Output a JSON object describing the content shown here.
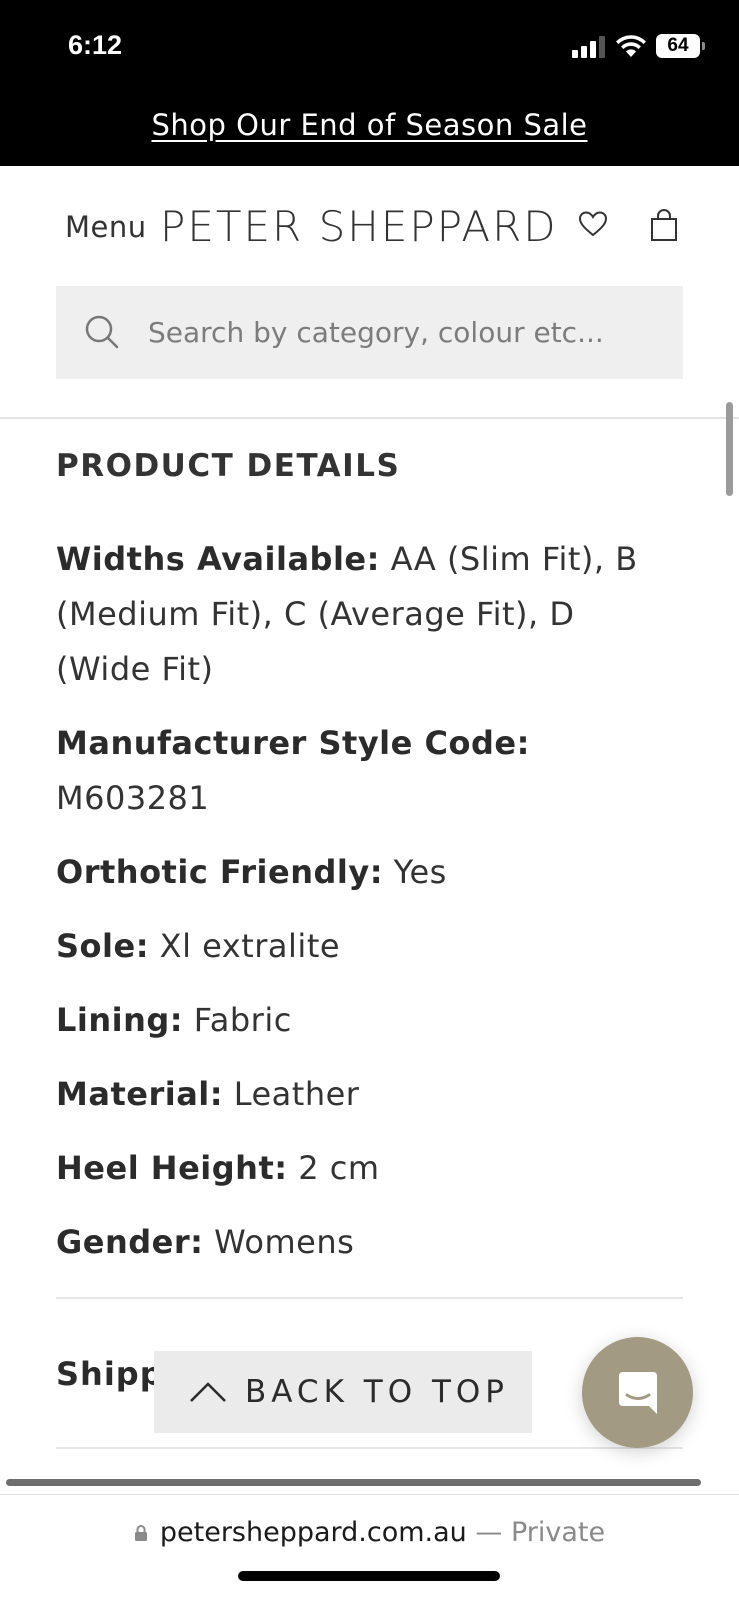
{
  "status_bar": {
    "time": "6:12",
    "battery": "64",
    "icons": [
      "signal-icon",
      "wifi-icon",
      "battery-icon"
    ]
  },
  "promo": {
    "text": "Shop Our End of Season Sale"
  },
  "header": {
    "menu_label": "Menu",
    "brand": "PETER SHEPPARD",
    "icons": [
      "heart-icon",
      "bag-icon"
    ]
  },
  "search": {
    "placeholder": "Search by category, colour etc...",
    "value": ""
  },
  "product_details": {
    "title": "PRODUCT DETAILS",
    "items": [
      {
        "label": "Widths Available:",
        "value": "AA (Slim Fit), B (Medium Fit), C (Average Fit), D (Wide Fit)"
      },
      {
        "label": "Manufacturer Style Code:",
        "value": "M603281"
      },
      {
        "label": "Orthotic Friendly:",
        "value": "Yes"
      },
      {
        "label": "Sole:",
        "value": "Xl extralite"
      },
      {
        "label": "Lining:",
        "value": "Fabric"
      },
      {
        "label": "Material:",
        "value": "Leather"
      },
      {
        "label": "Heel Height:",
        "value": "2 cm"
      },
      {
        "label": "Gender:",
        "value": "Womens"
      }
    ]
  },
  "shipping": {
    "label_visible": "Shipp"
  },
  "back_to_top": {
    "label": "BACK TO TOP"
  },
  "browser": {
    "domain": "petersheppard.com.au",
    "suffix": "— Private"
  },
  "colors": {
    "chat_button": "#a29a82",
    "search_bg": "#efefef",
    "back_to_top_bg": "#ebebeb"
  }
}
